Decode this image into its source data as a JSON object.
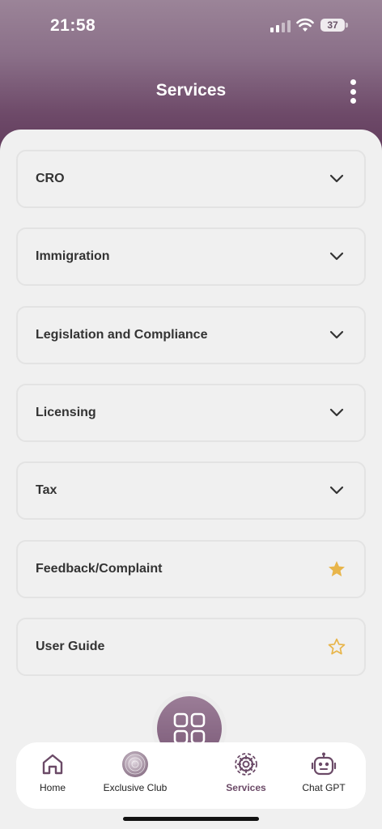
{
  "status": {
    "time": "21:58",
    "battery": "37"
  },
  "header": {
    "title": "Services"
  },
  "services": [
    {
      "label": "CRO",
      "icon": "chevron-down-icon"
    },
    {
      "label": "Immigration",
      "icon": "chevron-down-icon"
    },
    {
      "label": "Legislation and Compliance",
      "icon": "chevron-down-icon"
    },
    {
      "label": "Licensing",
      "icon": "chevron-down-icon"
    },
    {
      "label": "Tax",
      "icon": "chevron-down-icon"
    },
    {
      "label": "Feedback/Complaint",
      "icon": "star-filled-icon"
    },
    {
      "label": "User Guide",
      "icon": "star-outline-icon"
    }
  ],
  "nav": {
    "home": "Home",
    "club": "Exclusive Club",
    "services": "Services",
    "chat": "Chat GPT",
    "active": "Services"
  },
  "colors": {
    "accent": "#6b4a67",
    "star": "#e8b54a",
    "header_top": "#9b8498",
    "header_bottom": "#5f3a5a"
  }
}
